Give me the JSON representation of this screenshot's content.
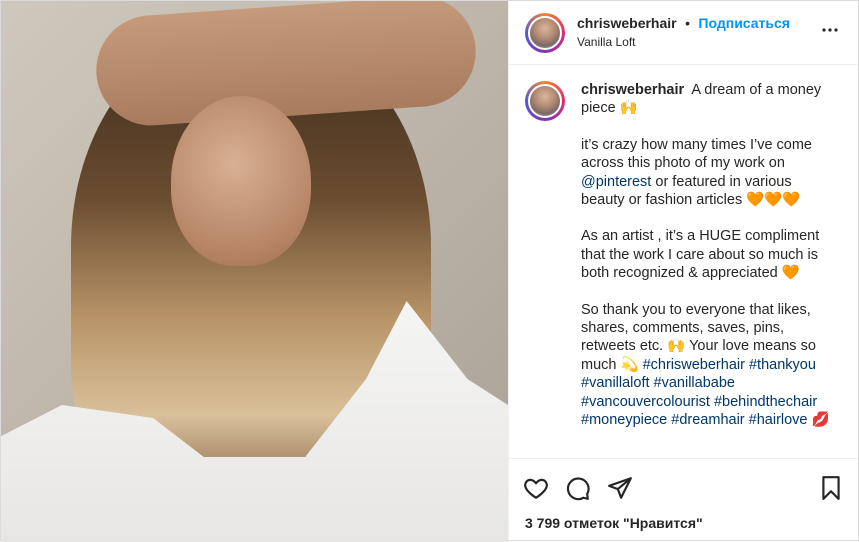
{
  "post": {
    "username": "chrisweberhair",
    "separator": "•",
    "follow_label": "Подписаться",
    "location": "Vanilla Loft",
    "more_icon": "more-options-icon"
  },
  "caption": {
    "username": "chrisweberhair",
    "line1": "A dream of a money piece",
    "emoji1": "🙌",
    "p2_a": "it’s crazy how many times I’ve come across this photo of my work on",
    "mention": "@pinterest",
    "p2_b": "or featured in various beauty or fashion articles",
    "hearts3": "🧡🧡🧡",
    "p3": "As an artist , it’s a HUGE compliment that the work I care about so much is both recognized & appreciated",
    "heart1": "🧡",
    "p4_a": "So thank you to everyone that likes, shares, comments, saves, pins, retweets etc.",
    "emoji2": "🙌",
    "p4_b": "Your love means so much",
    "emoji3": "💫",
    "hashtags": "#chrisweberhair #thankyou #vanillaloft #vanillababe #vancouvercolourist #behindthechair #moneypiece #dreamhair #hairlove",
    "lips": "💋"
  },
  "likes": "3 799 отметок \"Нравится\"",
  "colors": {
    "accent": "#0095f6",
    "link": "#00376b",
    "text": "#262626"
  }
}
